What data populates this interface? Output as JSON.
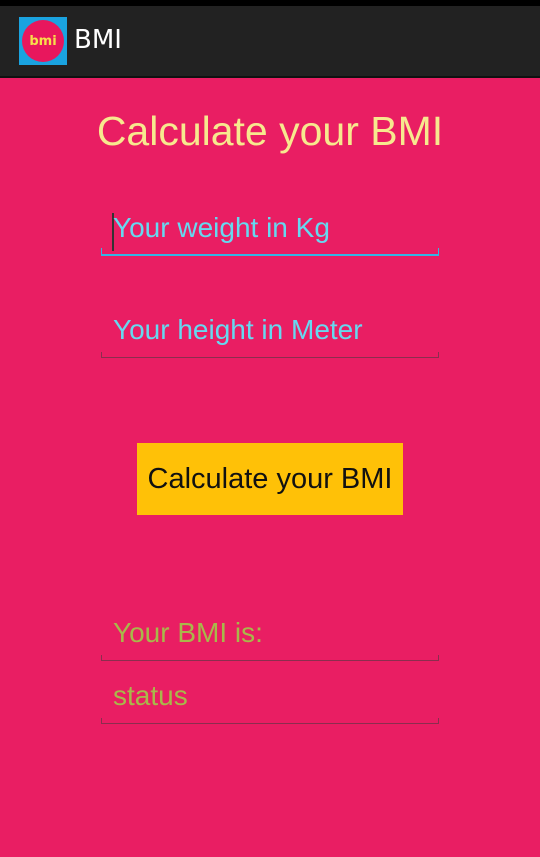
{
  "app": {
    "icon_text": "bmi",
    "title": "BMI"
  },
  "main": {
    "heading": "Calculate your BMI",
    "weight_placeholder": "Your weight in Kg",
    "height_placeholder": "Your height in Meter",
    "calculate_button": "Calculate your BMI",
    "bmi_result": "Your BMI is:",
    "status": "status"
  },
  "colors": {
    "background": "#E91E63",
    "action_bar": "#222222",
    "heading": "#F7E98E",
    "hint_text": "#66D9F0",
    "button": "#FFC107",
    "result_text": "#A8B84A",
    "focus_underline": "#33B5E5"
  }
}
